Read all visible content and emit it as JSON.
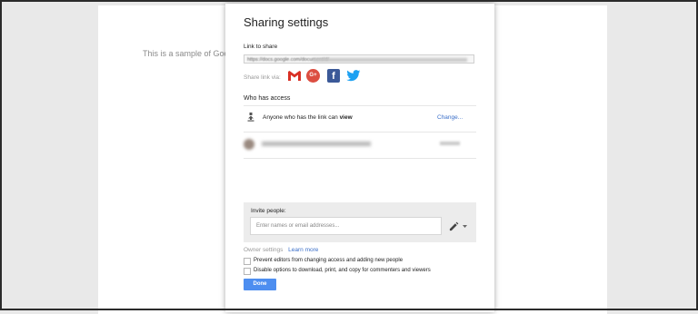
{
  "document": {
    "sample_text": "This is a sample of Google Docs."
  },
  "dialog": {
    "title": "Sharing settings",
    "link_label": "Link to share",
    "link_value": "https://docs.google.com/document/d/",
    "share_via_label": "Share link via:",
    "social_icons": [
      "gmail-icon",
      "google-plus-icon",
      "facebook-icon",
      "twitter-icon"
    ],
    "gplus_text": "G+",
    "facebook_text": "f",
    "who_has_access": "Who has access",
    "access_text": "Anyone who has the link can",
    "access_level": "view",
    "change_link": "Change...",
    "invite_label": "Invite people:",
    "invite_placeholder": "Enter names or email addresses...",
    "owner_settings_label": "Owner settings",
    "learn_more": "Learn more",
    "options": [
      "Prevent editors from changing access and adding new people",
      "Disable options to download, print, and copy for commenters and viewers"
    ],
    "done_button": "Done"
  },
  "colors": {
    "accent_blue": "#4d8ef0",
    "link_blue": "#3b6fc9",
    "facebook": "#3b5998",
    "google_plus": "#dc4e41",
    "twitter": "#1da1f2",
    "gmail_red": "#d93025"
  }
}
